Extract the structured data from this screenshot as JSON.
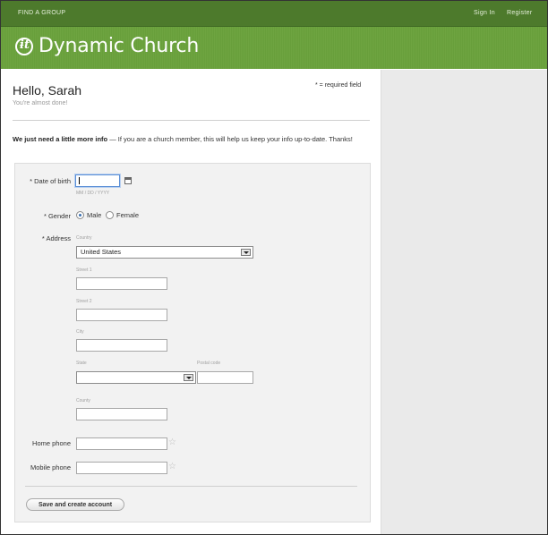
{
  "nav": {
    "find_group": "FIND A GROUP",
    "sign_in": "Sign In",
    "register": "Register"
  },
  "header": {
    "brand": "Dynamic Church",
    "logo_icon": "dynamic-church-logo"
  },
  "page": {
    "greeting": "Hello, Sarah",
    "subgreeting": "You're almost done!",
    "required_note": "* = required field",
    "intro_bold": "We just need a little more info",
    "intro_rest": " — If you are a church member, this will help us keep your info up-to-date. Thanks!"
  },
  "form": {
    "dob_label": "* Date of birth",
    "dob_value": "",
    "dob_hint": "MM / DD / YYYY",
    "gender_label": "* Gender",
    "gender_options": [
      "Male",
      "Female"
    ],
    "gender_selected": "Male",
    "address_label": "* Address",
    "country_label": "Country",
    "country_value": "United States",
    "street1_label": "Street 1",
    "street2_label": "Street 2",
    "city_label": "City",
    "state_label": "State",
    "state_value": "",
    "postal_label": "Postal code",
    "county_label": "County",
    "home_phone_label": "Home phone",
    "mobile_phone_label": "Mobile phone",
    "submit_label": "Save and create account"
  },
  "colors": {
    "nav_bg": "#4d7a2c",
    "header_bg": "#6aa23c",
    "side_panel": "#eaeaea"
  }
}
